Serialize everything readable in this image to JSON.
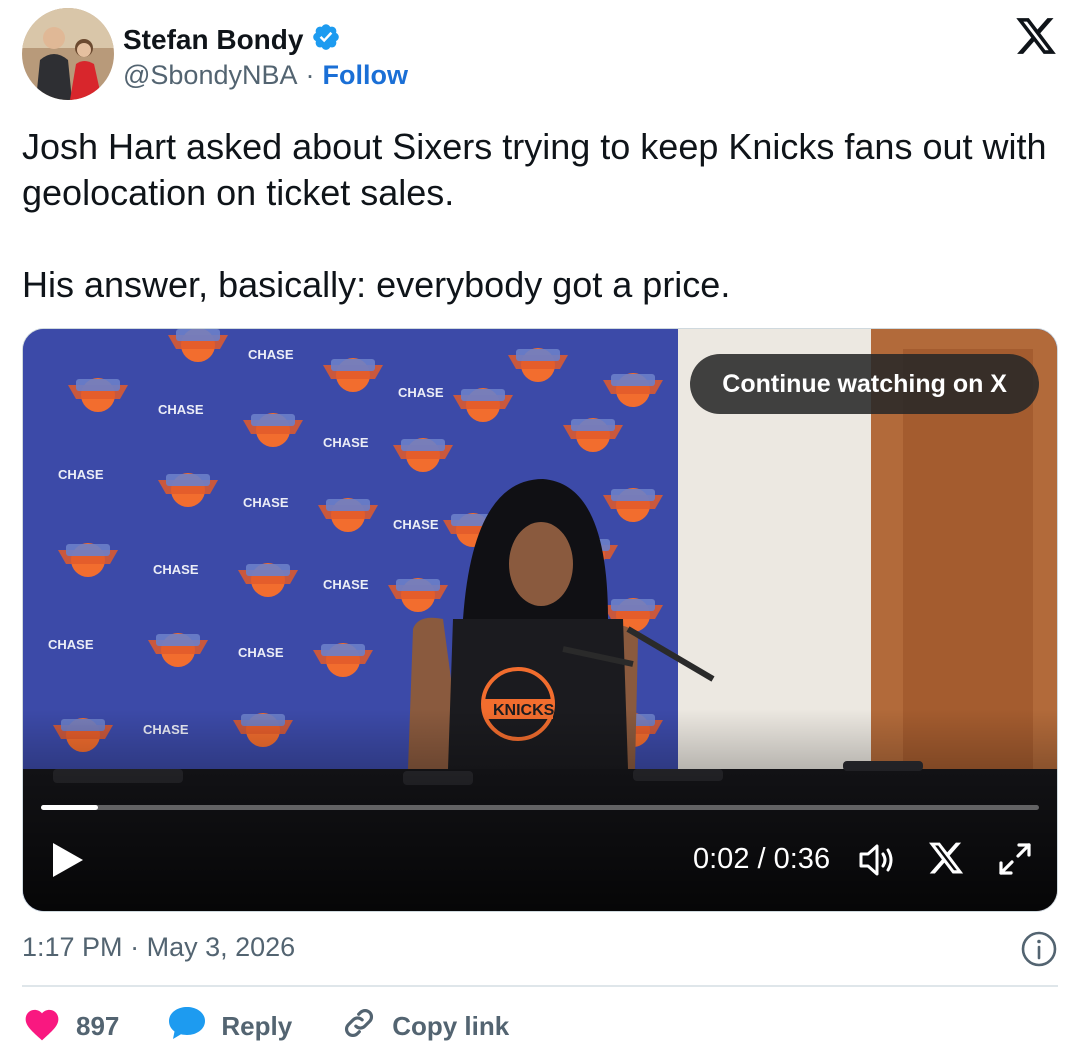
{
  "author": {
    "display_name": "Stefan Bondy",
    "handle": "@SbondyNBA",
    "separator": "·",
    "follow_label": "Follow",
    "verified": true
  },
  "tweet": {
    "paragraphs": [
      "Josh Hart asked about Sixers trying to keep Knicks fans out with geolocation on ticket sales.",
      "His answer, basically: everybody got a price."
    ]
  },
  "video": {
    "continue_label": "Continue watching on X",
    "current_time": "0:02",
    "time_separator": " / ",
    "duration": "0:36",
    "progress_fraction": 0.057,
    "sponsor_text": "CHASE",
    "jersey_text": "KNICKS"
  },
  "meta": {
    "time": "1:17 PM",
    "separator": "·",
    "date": "May 3, 2026"
  },
  "actions": {
    "like_count": "897",
    "reply_label": "Reply",
    "copy_link_label": "Copy link"
  },
  "colors": {
    "accent_blue": "#1d9bf0",
    "like_pink": "#f91880",
    "text_primary": "#0f1419",
    "text_secondary": "#536471"
  }
}
